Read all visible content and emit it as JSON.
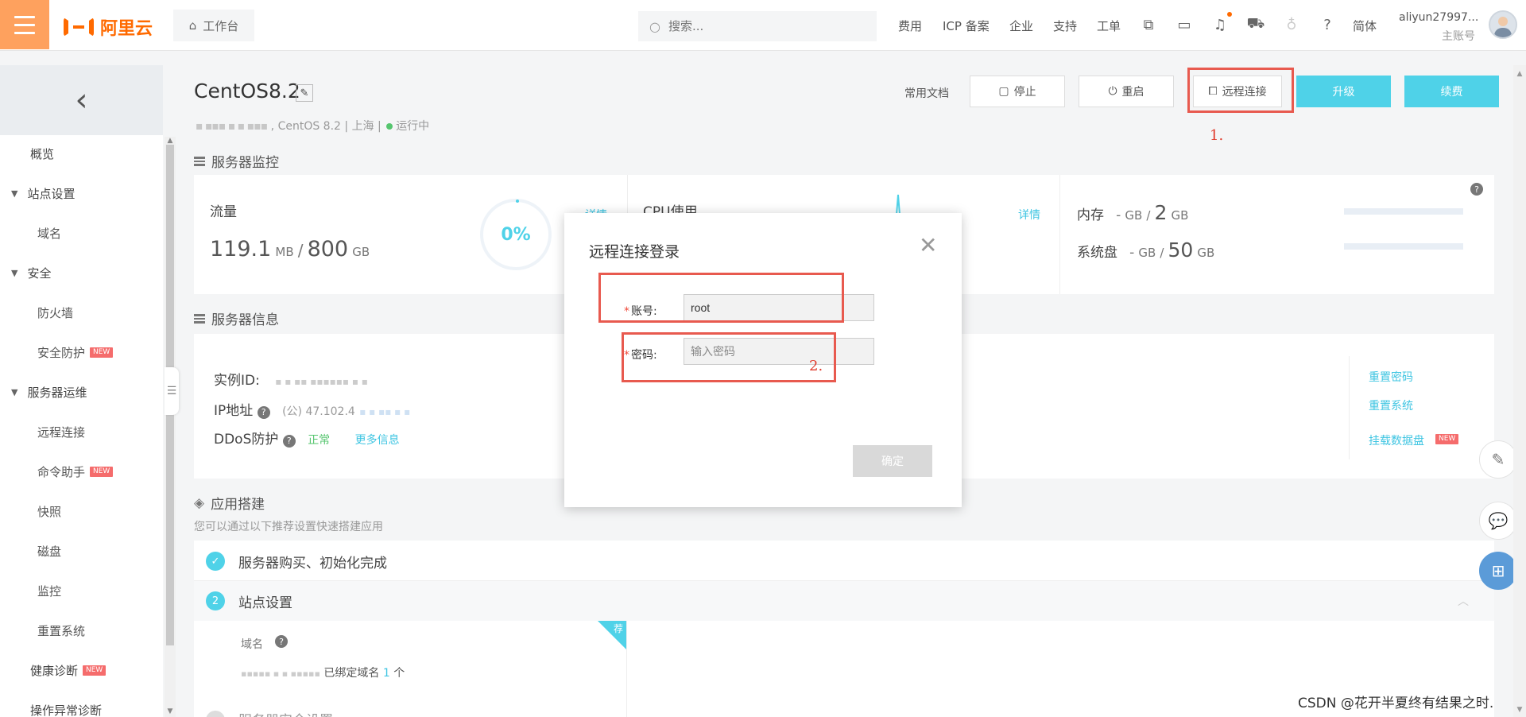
{
  "topbar": {
    "logo_text": "阿里云",
    "workbench": "工作台",
    "search_placeholder": "搜索...",
    "links": [
      "费用",
      "ICP 备案",
      "企业",
      "支持",
      "工单"
    ],
    "lang": "简体",
    "user_name": "aliyun27997...",
    "user_role": "主账号"
  },
  "sidebar": {
    "items": [
      {
        "label": "概览"
      },
      {
        "label": "站点设置"
      },
      {
        "label": "域名"
      },
      {
        "label": "安全"
      },
      {
        "label": "防火墙"
      },
      {
        "label": "安全防护",
        "badge": "NEW"
      },
      {
        "label": "服务器运维"
      },
      {
        "label": "远程连接"
      },
      {
        "label": "命令助手",
        "badge": "NEW"
      },
      {
        "label": "快照"
      },
      {
        "label": "磁盘"
      },
      {
        "label": "监控"
      },
      {
        "label": "重置系统"
      },
      {
        "label": "健康诊断",
        "badge": "NEW"
      },
      {
        "label": "操作异常诊断"
      }
    ]
  },
  "header": {
    "title": "CentOS8.2",
    "subtitle_os": "CentOS 8.2",
    "subtitle_region": "上海",
    "subtitle_status": "运行中",
    "docs": "常用文档",
    "stop": "停止",
    "restart": "重启",
    "remote": "远程连接",
    "upgrade": "升级",
    "renew": "续费"
  },
  "annotations": {
    "step1": "1.",
    "step2": "2."
  },
  "monitor": {
    "section_title": "服务器监控",
    "traffic_label": "流量",
    "traffic_used": "119.1",
    "traffic_used_unit": "MB",
    "traffic_total": "800",
    "traffic_total_unit": "GB",
    "traffic_percent": "0%",
    "details": "详情",
    "cpu_label": "CPU使用",
    "memory_label": "内存",
    "memory_used": "-",
    "memory_used_unit": "GB",
    "memory_total": "2",
    "memory_total_unit": "GB",
    "disk_label": "系统盘",
    "disk_used": "-",
    "disk_used_unit": "GB",
    "disk_total": "50",
    "disk_total_unit": "GB"
  },
  "info": {
    "section_title": "服务器信息",
    "instance_label": "实例ID:",
    "ip_label": "IP地址",
    "ip_value": "(公) 47.102.4",
    "ddos_label": "DDoS防护",
    "ddos_status": "正常",
    "more_info": "更多信息",
    "reset_password": "重置密码",
    "reset_system": "重置系统",
    "mount_disk": "挂载数据盘",
    "mount_badge": "NEW"
  },
  "app": {
    "section_title": "应用搭建",
    "hint": "您可以通过以下推荐设置快速搭建应用",
    "step1": "服务器购买、初始化完成",
    "step2_num": "2",
    "step2": "站点设置",
    "domain_label": "域名",
    "bound_text": "已绑定域名",
    "bound_count": "1",
    "bound_unit": "个",
    "recommend_badge": "荐",
    "step3_partial": "服务器安全设置"
  },
  "modal": {
    "title": "远程连接登录",
    "account_label": "账号:",
    "account_value": "root",
    "password_label": "密码:",
    "password_placeholder": "输入密码",
    "confirm": "确定"
  },
  "watermark": "CSDN @花开半夏终有结果之时."
}
